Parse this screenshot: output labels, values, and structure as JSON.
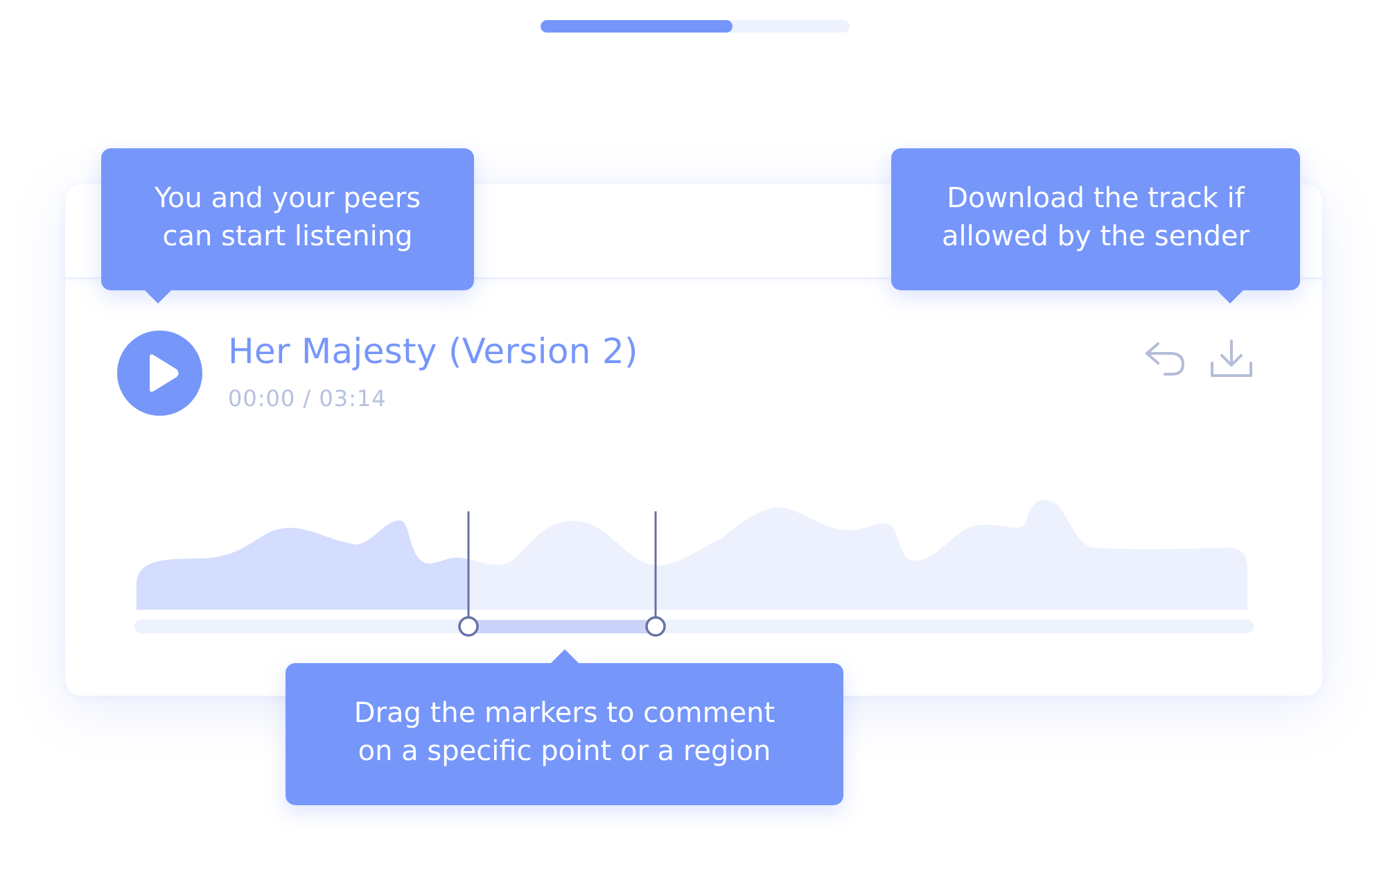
{
  "onboarding": {
    "step_progress": 0.62
  },
  "player": {
    "title": "Her Majesty (Version 2)",
    "time": "00:00 / 03:14",
    "play_icon": "play-icon",
    "reply_icon": "reply-icon",
    "download_icon": "download-icon"
  },
  "tooltips": {
    "play": "You and your peers\ncan start listening",
    "download": "Download the track if\nallowed by the sender",
    "markers": "Drag the markers to comment\non a specific point or a region"
  },
  "colors": {
    "accent": "#7696fa",
    "waveform_played": "#d4ddfd",
    "waveform_unplayed": "#edf1fe",
    "marker_line": "#6672a6",
    "selection": "#ccd3fa",
    "time_text": "#b6c0df",
    "icon_gray": "#b4bdd8"
  }
}
